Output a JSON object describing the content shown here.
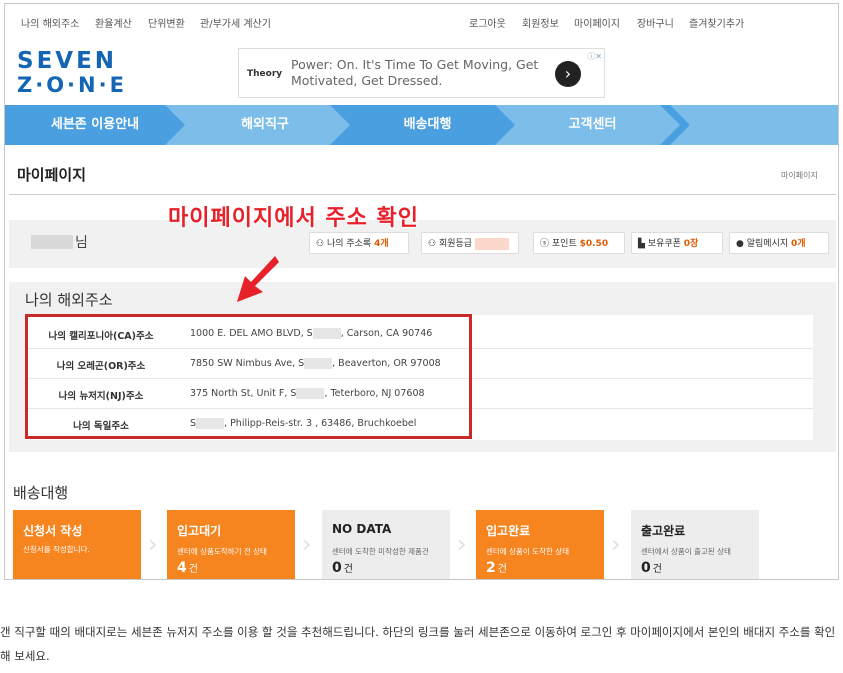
{
  "top_links_left": [
    "나의 해외주소",
    "환율계산",
    "단위변환",
    "관/부가세 계산기"
  ],
  "top_links_right": [
    "로그아웃",
    "회원정보",
    "마이페이지",
    "장바구니",
    "즐겨찾기추가"
  ],
  "logo": {
    "line1": "SEVEN",
    "line2": "Z·O·N·E"
  },
  "ad": {
    "brand": "Theory",
    "text": "Power: On. It's Time To Get Moving, Get Motivated, Get Dressed.",
    "go_icon": "chevron-right-icon",
    "info_icon": "ⓘ✕"
  },
  "nav": {
    "items": [
      "세븐존 이용안내",
      "해외직구",
      "배송대행",
      "고객센터"
    ]
  },
  "page": {
    "title": "마이페이지",
    "breadcrumb": "마이페이지"
  },
  "user": {
    "name_suffix": "님",
    "address_book": {
      "label": "나의 주소록",
      "value": "4개"
    },
    "grade": {
      "label": "회원등급"
    },
    "points": {
      "label": "포인트",
      "value": "$0.50"
    },
    "coupons": {
      "label": "보유쿠폰",
      "value": "0장"
    },
    "messages": {
      "label": "알림메시지",
      "value": "0개"
    }
  },
  "annotation": "마이페이지에서 주소 확인",
  "address_section": {
    "title": "나의 해외주소",
    "rows": [
      {
        "label": "나의 캘리포니아(CA)주소",
        "pre": "1000 E. DEL AMO BLVD, S",
        "post": ", Carson, CA   90746"
      },
      {
        "label": "나의 오레곤(OR)주소",
        "pre": "7850 SW Nimbus Ave, S",
        "post": ", Beaverton, OR   97008"
      },
      {
        "label": "나의 뉴저지(NJ)주소",
        "pre": "375 North St, Unit F, S",
        "post": ", Teterboro, NJ   07608"
      },
      {
        "label": "나의 독일주소",
        "pre": "S",
        "post": ", Philipp-Reis-str. 3 , 63486, Bruchkoebel"
      }
    ]
  },
  "delivery": {
    "title": "배송대행",
    "cards": [
      {
        "title": "신청서 작성",
        "desc": "신청서를 작성합니다.",
        "count": "",
        "unit": ""
      },
      {
        "title": "입고대기",
        "desc": "센터에 상품도착하기 전 상태",
        "count": "4",
        "unit": "건"
      },
      {
        "title": "NO DATA",
        "desc": "센터에 도착한 미작성한 제품건",
        "count": "0",
        "unit": "건"
      },
      {
        "title": "입고완료",
        "desc": "센터에 상품이 도착한 상태",
        "count": "2",
        "unit": "건"
      },
      {
        "title": "출고완료",
        "desc": "센터에서 상품이 출고된 상태",
        "count": "0",
        "unit": "건"
      }
    ]
  },
  "footer_note": "갠 직구할 때의 배대지로는 세븐존 뉴저지 주소를 이용 할 것을 추천해드립니다. 하단의 링크를 눌러 세븐존으로 이동하여 로그인 후 마이페이지에서 본인의 배대지 주소를 확인해 보세요.",
  "colors": {
    "brand_blue": "#1565b5",
    "nav_blue": "#7dbde9",
    "nav_dark": "#4a9fe0",
    "orange": "#f6851f",
    "accent_red": "#e8202a"
  }
}
